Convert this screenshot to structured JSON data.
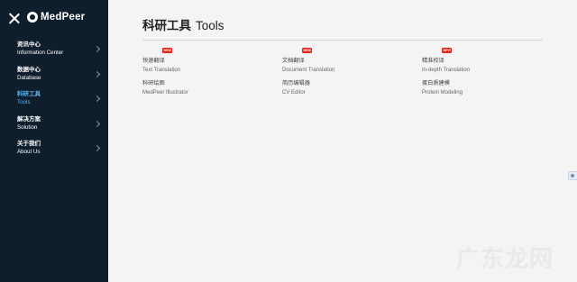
{
  "brand": {
    "name": "MedPeer"
  },
  "nav": {
    "items": [
      {
        "zh": "资讯中心",
        "en": "Information Center",
        "active": false
      },
      {
        "zh": "数据中心",
        "en": "Database",
        "active": false
      },
      {
        "zh": "科研工具",
        "en": "Tools",
        "active": true
      },
      {
        "zh": "解决方案",
        "en": "Solution",
        "active": false
      },
      {
        "zh": "关于我们",
        "en": "About Us",
        "active": false
      }
    ]
  },
  "page": {
    "title_zh": "科研工具",
    "title_en": "Tools"
  },
  "tools": [
    {
      "zh": "快速翻译",
      "en": "Text Translation",
      "badge": "NEW"
    },
    {
      "zh": "文档翻译",
      "en": "Document Translation",
      "badge": "NEW"
    },
    {
      "zh": "精准校译",
      "en": "In-depth Translation",
      "badge": "NEW"
    },
    {
      "zh": "科研绘图",
      "en": "MedPeer Illustrator"
    },
    {
      "zh": "简历编辑器",
      "en": "CV Editor"
    },
    {
      "zh": "蛋白质建模",
      "en": "Protein Modeling"
    }
  ],
  "watermark": "广东龙网",
  "colors": {
    "sidebar_bg": "#0f1e2c",
    "active": "#5bb5ee",
    "badge": "#e62117",
    "main_bg": "#f4f4f4"
  }
}
